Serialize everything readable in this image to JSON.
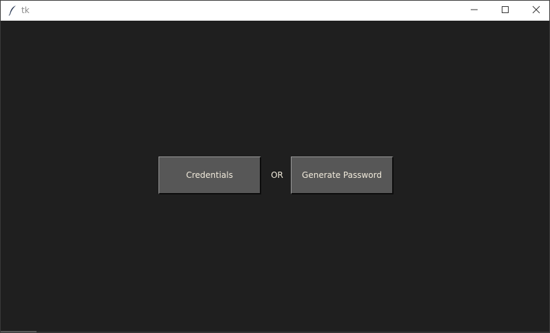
{
  "window": {
    "title": "tk",
    "icon": "feather-icon",
    "controls": {
      "minimize": "minimize-icon",
      "maximize": "maximize-icon",
      "close": "close-icon"
    }
  },
  "main": {
    "credentials_label": "Credentials",
    "or_label": "OR",
    "generate_label": "Generate Password"
  },
  "colors": {
    "background": "#1f1f1f",
    "button_bg": "#575757",
    "button_text": "#f0eadb",
    "titlebar_bg": "#ffffff"
  }
}
